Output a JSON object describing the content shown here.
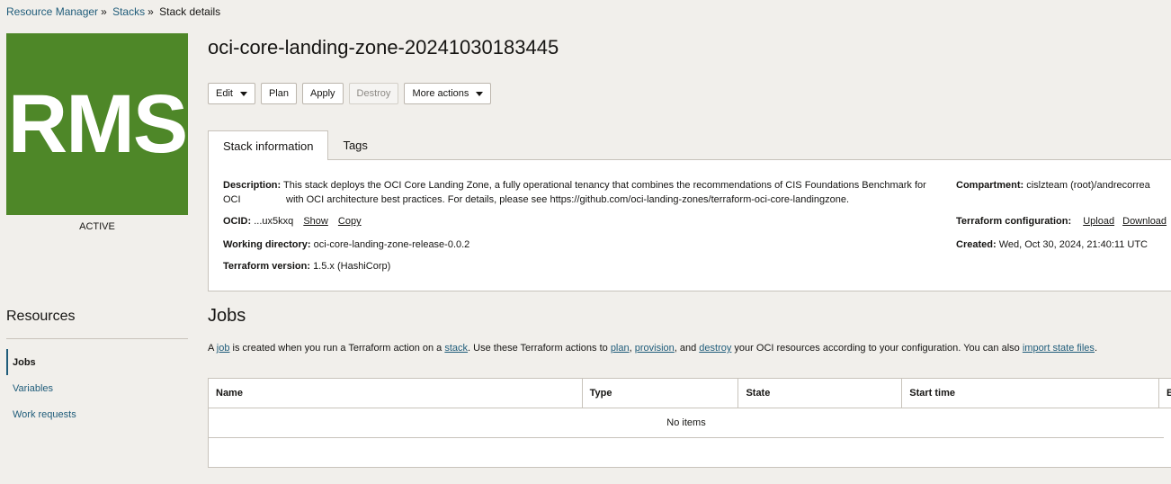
{
  "breadcrumb": {
    "items": [
      "Resource Manager",
      "Stacks",
      "Stack details"
    ],
    "separator": "»"
  },
  "logo": {
    "text": "RMS",
    "color": "#4e8728"
  },
  "stack_status": "ACTIVE",
  "page_title": "oci-core-landing-zone-20241030183445",
  "toolbar": {
    "edit_label": "Edit",
    "plan_label": "Plan",
    "apply_label": "Apply",
    "destroy_label": "Destroy",
    "more_actions_label": "More actions"
  },
  "tabs": [
    {
      "label": "Stack information",
      "active": true
    },
    {
      "label": "Tags",
      "active": false
    }
  ],
  "stack_info": {
    "description_label": "Description:",
    "description_line1": "This stack deploys the OCI Core Landing Zone, a fully operational tenancy that combines the recommendations of CIS Foundations Benchmark for OCI",
    "description_line2": "with OCI architecture best practices. For details, please see https://github.com/oci-landing-zones/terraform-oci-core-landingzone.",
    "ocid_label": "OCID:",
    "ocid_value": "...ux5kxq",
    "ocid_show": "Show",
    "ocid_copy": "Copy",
    "working_dir_label": "Working directory:",
    "working_dir_value": "oci-core-landing-zone-release-0.0.2",
    "tf_version_label": "Terraform version:",
    "tf_version_value": "1.5.x (HashiCorp)",
    "compartment_label": "Compartment:",
    "compartment_value": "cislzteam (root)/andrecorrea",
    "tf_config_label": "Terraform configuration:",
    "tf_config_upload": "Upload",
    "tf_config_download": "Download",
    "created_label": "Created:",
    "created_value": "Wed, Oct 30, 2024, 21:40:11 UTC"
  },
  "sidebar": {
    "title": "Resources",
    "items": [
      {
        "label": "Jobs",
        "active": true
      },
      {
        "label": "Variables",
        "active": false
      },
      {
        "label": "Work requests",
        "active": false
      }
    ]
  },
  "jobs": {
    "title": "Jobs",
    "desc": {
      "t1": "A ",
      "l1": "job",
      "t2": " is created when you run a Terraform action on a ",
      "l2": "stack",
      "t3": ". Use these Terraform actions to ",
      "l3": "plan",
      "t4": ", ",
      "l4": "provision",
      "t5": ", and ",
      "l5": "destroy",
      "t6": " your OCI resources according to your configuration. You can also ",
      "l6": "import state files",
      "t7": "."
    },
    "columns": [
      "Name",
      "Type",
      "State",
      "Start time",
      "E"
    ],
    "empty_text": "No items"
  }
}
